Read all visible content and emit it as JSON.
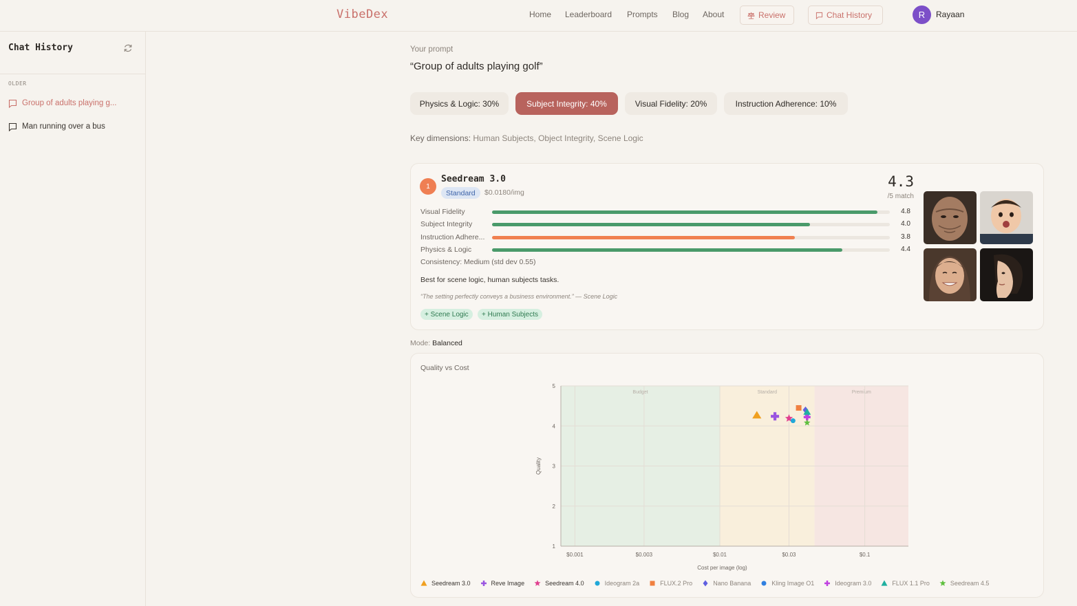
{
  "nav": {
    "logo": "VibeDex",
    "links": [
      "Home",
      "Leaderboard",
      "Prompts",
      "Blog",
      "About"
    ],
    "review_label": "Review",
    "chat_history_label": "Chat History",
    "avatar_initial": "R",
    "username": "Rayaan"
  },
  "sidebar": {
    "title": "Chat History",
    "section_label": "OLDER",
    "items": [
      {
        "label": "Group of adults playing g...",
        "active": true
      },
      {
        "label": "Man running over a bus",
        "active": false
      }
    ]
  },
  "main": {
    "prompt_label": "Your prompt",
    "prompt_text": "“Group of adults playing golf”",
    "weights": [
      {
        "label": "Physics & Logic: 30%",
        "active": false
      },
      {
        "label": "Subject Integrity: 40%",
        "active": true
      },
      {
        "label": "Visual Fidelity: 20%",
        "active": false
      },
      {
        "label": "Instruction Adherence: 10%",
        "active": false
      }
    ],
    "key_dimensions_label": "Key dimensions:",
    "key_dimensions_value": "Human Subjects, Object Integrity, Scene Logic",
    "result": {
      "rank": "1",
      "model": "Seedream 3.0",
      "tier": "Standard",
      "price": "$0.0180/img",
      "score": "4.3",
      "score_sub": "/5 match",
      "metrics": [
        {
          "label": "Visual Fidelity",
          "value": "4.8",
          "fraction": 0.968,
          "color": "#4a9a6a"
        },
        {
          "label": "Subject Integrity",
          "value": "4.0",
          "fraction": 0.8,
          "color": "#4a9a6a"
        },
        {
          "label": "Instruction Adhere...",
          "value": "3.8",
          "fraction": 0.762,
          "color": "#f08050"
        },
        {
          "label": "Physics & Logic",
          "value": "4.4",
          "fraction": 0.88,
          "color": "#4a9a6a"
        }
      ],
      "consistency": "Consistency: Medium (std dev 0.55)",
      "best_for": "Best for scene logic, human subjects tasks.",
      "quote": "“The setting perfectly conveys a business environment.” — Scene Logic",
      "tags": [
        "+ Scene Logic",
        "+ Human Subjects"
      ]
    },
    "mode_label": "Mode:",
    "mode_value": "Balanced"
  },
  "chart_data": {
    "type": "scatter",
    "title": "Quality vs Cost",
    "xlabel": "Cost per image (log)",
    "ylabel": "Quality",
    "x_scale": "log",
    "xlim": [
      0.0008,
      0.2
    ],
    "ylim": [
      1,
      5
    ],
    "x_ticks": [
      0.001,
      0.003,
      0.01,
      0.03,
      0.1
    ],
    "x_tick_labels": [
      "$0.001",
      "$0.003",
      "$0.01",
      "$0.03",
      "$0.1"
    ],
    "y_ticks": [
      1,
      2,
      3,
      4,
      5
    ],
    "grid": true,
    "zones": [
      {
        "label": "Budget",
        "from": 0.0008,
        "to": 0.01,
        "color": "#e6efe4"
      },
      {
        "label": "Standard",
        "from": 0.01,
        "to": 0.045,
        "color": "#f9efdc"
      },
      {
        "label": "Premium",
        "from": 0.045,
        "to": 0.2,
        "color": "#f6e6e2"
      }
    ],
    "series": [
      {
        "name": "Seedream 3.0",
        "x": 0.018,
        "y": 4.27,
        "color": "#f0a020",
        "marker": "triangle",
        "highlight": true
      },
      {
        "name": "Reve Image",
        "x": 0.024,
        "y": 4.24,
        "color": "#9a55e0",
        "marker": "plus",
        "highlight": true
      },
      {
        "name": "Seedream 4.0",
        "x": 0.03,
        "y": 4.19,
        "color": "#e04090",
        "marker": "star",
        "highlight": true
      },
      {
        "name": "Ideogram 2a",
        "x": 0.032,
        "y": 4.13,
        "color": "#20a8d8",
        "marker": "circle",
        "highlight": false
      },
      {
        "name": "FLUX.2 Pro",
        "x": 0.035,
        "y": 4.45,
        "color": "#f08040",
        "marker": "square",
        "highlight": false
      },
      {
        "name": "Nano Banana",
        "x": 0.039,
        "y": 4.4,
        "color": "#6060e0",
        "marker": "diamond",
        "highlight": false
      },
      {
        "name": "Kling Image O1",
        "x": 0.04,
        "y": 4.3,
        "color": "#3080e0",
        "marker": "circle",
        "highlight": false
      },
      {
        "name": "Ideogram 3.0",
        "x": 0.04,
        "y": 4.22,
        "color": "#c040e0",
        "marker": "plus",
        "highlight": false
      },
      {
        "name": "FLUX 1.1 Pro",
        "x": 0.04,
        "y": 4.35,
        "color": "#20b0a0",
        "marker": "triangle",
        "highlight": false
      },
      {
        "name": "Seedream 4.5",
        "x": 0.04,
        "y": 4.08,
        "color": "#60c040",
        "marker": "star",
        "highlight": false
      }
    ]
  }
}
